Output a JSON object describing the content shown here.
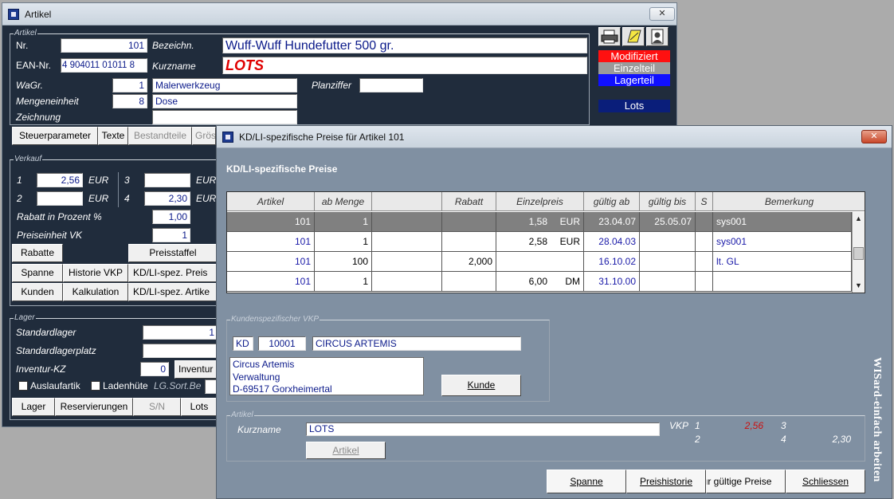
{
  "article_window": {
    "title": "Artikel",
    "close": "✕",
    "group_artikel": "Artikel",
    "nr_label": "Nr.",
    "nr_value": "101",
    "bezeichn_label": "Bezeichn.",
    "bezeichn_value": "Wuff-Wuff Hundefutter 500 gr.",
    "ean_label": "EAN-Nr.",
    "ean_value": "4 904011 01011 8",
    "kurzname_label": "Kurzname",
    "kurzname_value": "LOTS",
    "wagr_label": "WaGr.",
    "wagr_value": "1",
    "wagr_text": "Malerwerkzeug",
    "planziffer_label": "Planziffer",
    "planziffer_value": "",
    "mengeneinheit_label": "Mengeneinheit",
    "mengeneinheit_value": "8",
    "mengeneinheit_text": "Dose",
    "zeichnung_label": "Zeichnung",
    "zeichnung_value": "",
    "tabs": [
      "Steuerparameter",
      "Texte",
      "Bestandteile",
      "Grös"
    ],
    "status": [
      "Modifiziert",
      "Einzelteil",
      "Lagerteil"
    ],
    "lots_badge": "Lots",
    "group_verkauf": "Verkauf",
    "vk1_label": "1",
    "vk1_value": "2,56",
    "vk2_label": "2",
    "vk2_value": "",
    "vk3_label": "3",
    "vk3_value": "",
    "vk4_label": "4",
    "vk4_value": "2,30",
    "eur": "EUR",
    "rabatt_label": "Rabatt in Prozent %",
    "rabatt_value": "1,00",
    "preiseinheit_label": "Preiseinheit VK",
    "preiseinheit_value": "1",
    "btn_rabatte": "Rabatte",
    "btn_preisstaffel": "Preisstaffel",
    "btn_spanne": "Spanne",
    "btn_historie": "Historie VKP",
    "btn_kdli_preis": "KD/LI-spez. Preis",
    "btn_kunden": "Kunden",
    "btn_kalkulation": "Kalkulation",
    "btn_kdli_artikel": "KD/LI-spez. Artike",
    "group_lager": "Lager",
    "standardlager_label": "Standardlager",
    "standardlager_value": "1",
    "standardlagerplatz_label": "Standardlagerplatz",
    "standardlagerplatz_value": "",
    "inventur_label": "Inventur-KZ",
    "inventur_value": "0",
    "btn_inventur": "Inventur",
    "auslauf_label": "Auslaufartik",
    "ladenhueter_label": "Ladenhüte",
    "lgsort_label": "LG.Sort.Be",
    "btn_lager": "Lager",
    "btn_reservierungen": "Reservierungen",
    "btn_sn": "S/N",
    "btn_lots": "Lots"
  },
  "dialog": {
    "title": "KD/LI-spezifische Preise für Artikel 101",
    "close": "✕",
    "heading": "KD/LI-spezifische Preise",
    "columns": [
      "Artikel",
      "ab Menge",
      "",
      "Rabatt",
      "Einzelpreis",
      "gültig ab",
      "gültig bis",
      "S",
      "Bemerkung"
    ],
    "rows": [
      {
        "artikel": "101",
        "ab_menge": "1",
        "blank": "",
        "rabatt": "",
        "preis": "1,58",
        "waehrung": "EUR",
        "ab": "23.04.07",
        "bis": "25.05.07",
        "s": "",
        "bemerkung": "sys001"
      },
      {
        "artikel": "101",
        "ab_menge": "1",
        "blank": "",
        "rabatt": "",
        "preis": "2,58",
        "waehrung": "EUR",
        "ab": "28.04.03",
        "bis": "",
        "s": "",
        "bemerkung": "sys001"
      },
      {
        "artikel": "101",
        "ab_menge": "100",
        "blank": "",
        "rabatt": "2,000",
        "preis": "",
        "waehrung": "",
        "ab": "16.10.02",
        "bis": "",
        "s": "",
        "bemerkung": "lt. GL"
      },
      {
        "artikel": "101",
        "ab_menge": "1",
        "blank": "",
        "rabatt": "",
        "preis": "6,00",
        "waehrung": "DM",
        "ab": "31.10.00",
        "bis": "",
        "s": "",
        "bemerkung": ""
      }
    ],
    "group_kunde": "Kundenspezifischer VKP",
    "kd_type": "KD",
    "kd_number": "10001",
    "kd_name": "CIRCUS ARTEMIS",
    "address": [
      "Circus Artemis",
      "Verwaltung",
      "D-69517 Gorxheimertal"
    ],
    "btn_kunde": "Kunde",
    "group_artikel": "Artikel",
    "kurzname_label": "Kurzname",
    "kurzname_value": "LOTS",
    "btn_artikel": "Artikel",
    "vkp_label": "VKP",
    "vkp1_label": "1",
    "vkp1_value": "2,56",
    "vkp2_label": "2",
    "vkp2_value": "",
    "vkp3_label": "3",
    "vkp3_value": "",
    "vkp4_label": "4",
    "vkp4_value": "2,30",
    "vertical_text": "WISard-einfach arbeiten",
    "btn_spanne": "Spanne",
    "btn_preishistorie": "Preishistorie",
    "btn_nur_gueltige": "nur gültige Preise",
    "btn_schliessen": "Schliessen"
  }
}
